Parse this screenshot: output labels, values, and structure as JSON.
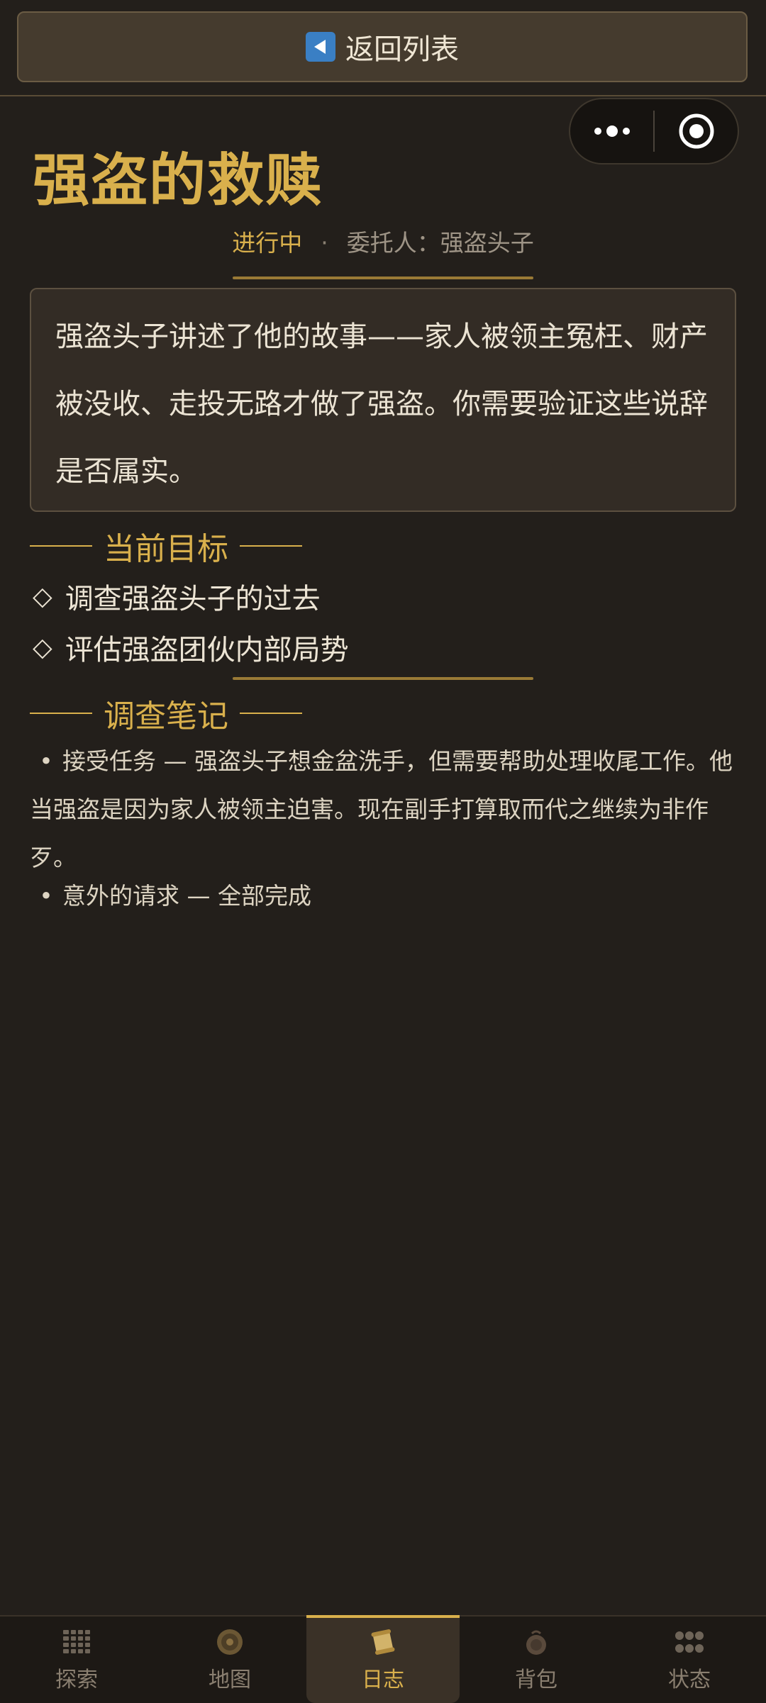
{
  "header": {
    "back_label": "返回列表",
    "back_icon": "play-left-icon"
  },
  "capsule": {
    "more_icon": "more-dots-icon",
    "close_icon": "target-circle-icon"
  },
  "quest": {
    "title": "强盗的救赎",
    "status": "进行中",
    "separator": "·",
    "client": "委托人：强盗头子",
    "description": "强盗头子讲述了他的故事——家人被领主冤枉、财产被没收、走投无路才做了强盗。你需要验证这些说辞是否属实。"
  },
  "goals": {
    "heading": "当前目标",
    "items": [
      "调查强盗头子的过去",
      "评估强盗团伙内部局势"
    ]
  },
  "notes": {
    "heading": "调查笔记",
    "items": [
      "接受任务 — 强盗头子想金盆洗手，但需要帮助处理收尾工作。他当强盗是因为家人被领主迫害。现在副手打算取而代之继续为非作歹。",
      "意外的请求 — 全部完成"
    ]
  },
  "nav": {
    "items": [
      {
        "label": "探索",
        "icon": "grid-tiles-icon"
      },
      {
        "label": "地图",
        "icon": "coin-map-icon"
      },
      {
        "label": "日志",
        "icon": "scroll-icon"
      },
      {
        "label": "背包",
        "icon": "bag-icon"
      },
      {
        "label": "状态",
        "icon": "dots-status-icon"
      }
    ],
    "active_index": 2
  },
  "colors": {
    "accent": "#d9b04c",
    "background": "#231f1b",
    "back_icon_bg": "#3a7fc4"
  }
}
